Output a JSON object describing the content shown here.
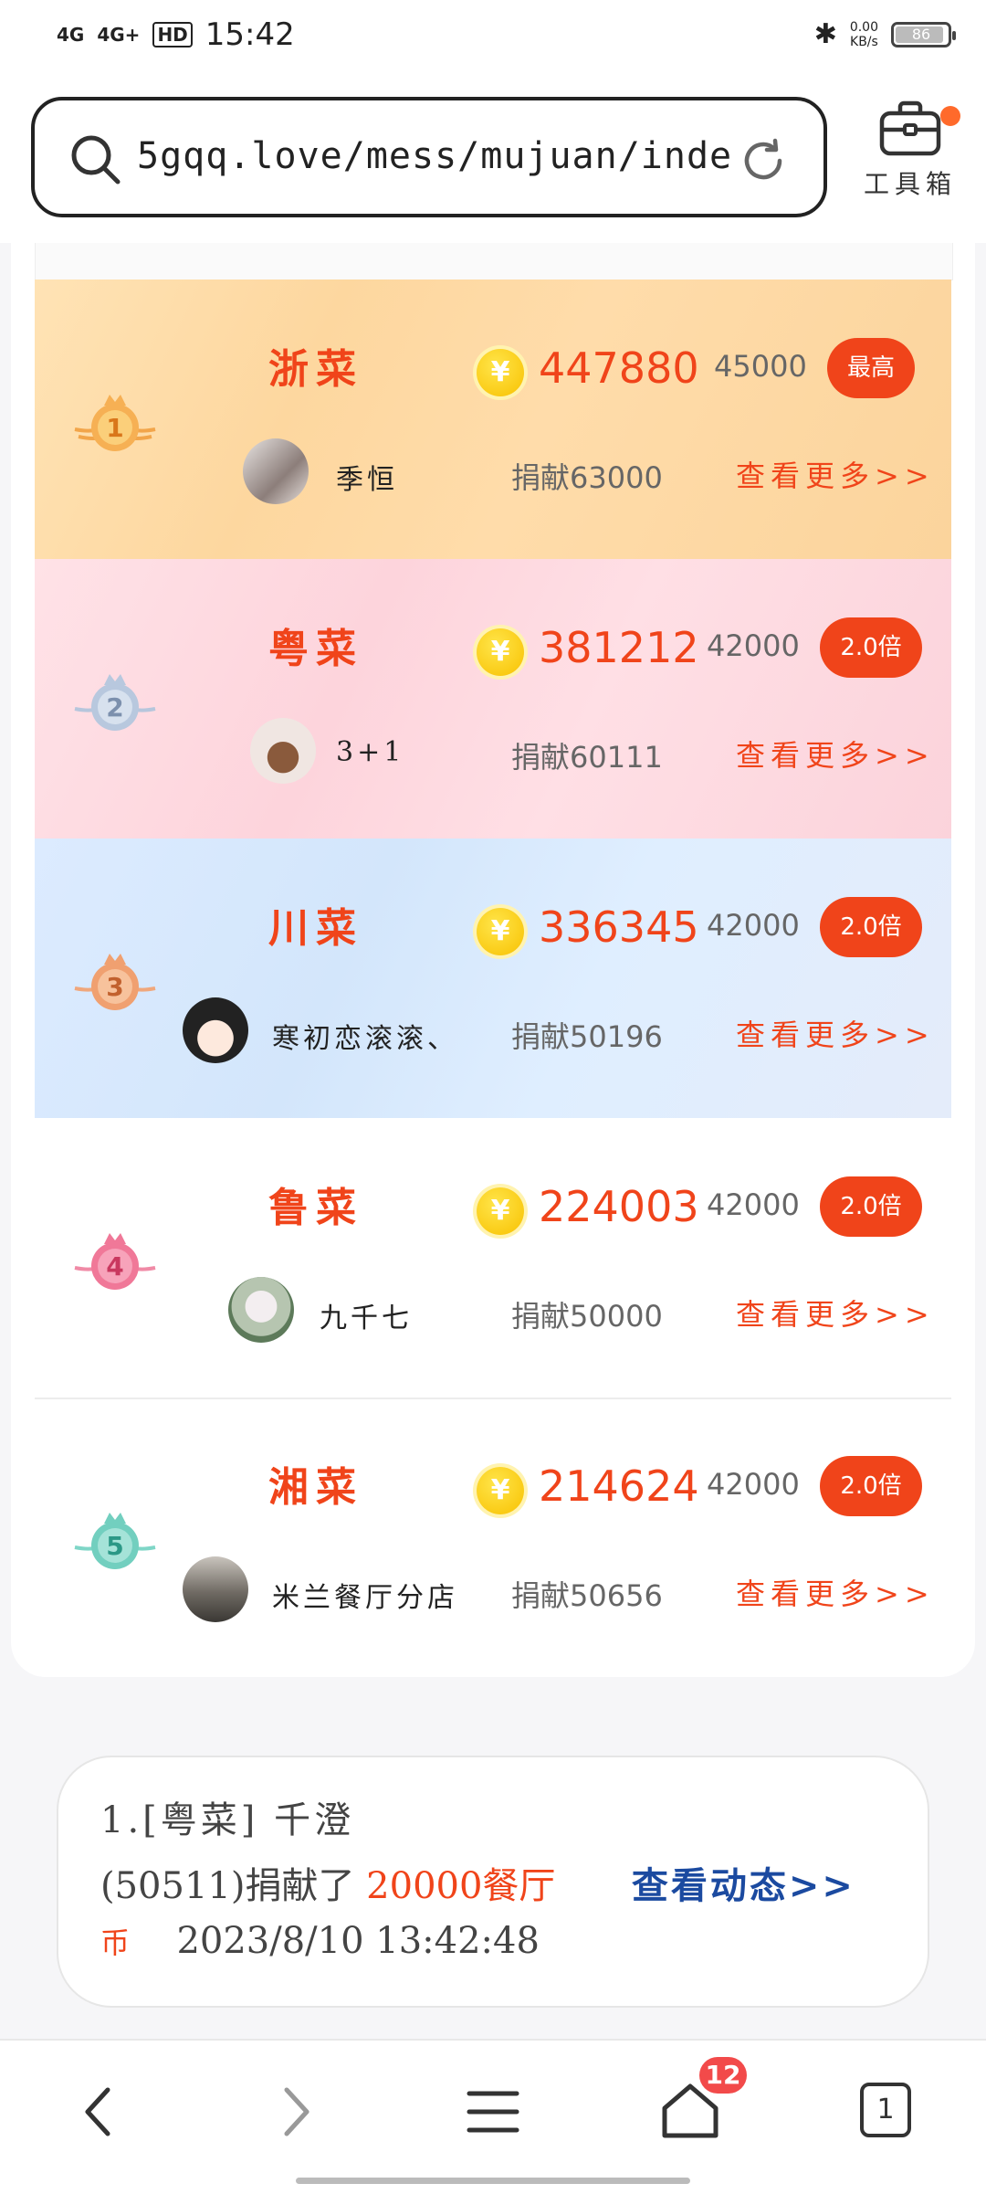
{
  "status_bar": {
    "signal1": "4G",
    "signal2": "4G+",
    "hd": "HD",
    "time": "15:42",
    "speed_value": "0.00",
    "speed_unit": "KB/s",
    "battery": "86"
  },
  "browser": {
    "url": "5gqq.love/mess/mujuan/inde…",
    "toolbox_label": "工具箱"
  },
  "ranking": [
    {
      "rank": 1,
      "cuisine": "浙菜",
      "score": "447880",
      "bid": "45000",
      "tag": "最高",
      "user": "季恒",
      "donation": "捐献63000",
      "more": "查看更多>>"
    },
    {
      "rank": 2,
      "cuisine": "粤菜",
      "score": "381212",
      "bid": "42000",
      "tag": "2.0倍",
      "user": "3+1",
      "donation": "捐献60111",
      "more": "查看更多>>"
    },
    {
      "rank": 3,
      "cuisine": "川菜",
      "score": "336345",
      "bid": "42000",
      "tag": "2.0倍",
      "user": "寒初恋滚滚、",
      "donation": "捐献50196",
      "more": "查看更多>>"
    },
    {
      "rank": 4,
      "cuisine": "鲁菜",
      "score": "224003",
      "bid": "42000",
      "tag": "2.0倍",
      "user": "九千七",
      "donation": "捐献50000",
      "more": "查看更多>>"
    },
    {
      "rank": 5,
      "cuisine": "湘菜",
      "score": "214624",
      "bid": "42000",
      "tag": "2.0倍",
      "user": "米兰餐厅分店",
      "donation": "捐献50656",
      "more": "查看更多>>"
    }
  ],
  "coin_symbol": "¥",
  "activity": {
    "line1": "1.[粤菜]  千澄",
    "line2_prefix": "(50511)捐献了 ",
    "amount": "20000餐厅",
    "link": "查看动态>>",
    "currency": "币",
    "timestamp": "2023/8/10 13:42:48"
  },
  "nav": {
    "tabs_badge": "12",
    "page_count": "1"
  },
  "colors": {
    "accent": "#f0441a",
    "link": "#1b4aa0",
    "gold_row": "#fdd79f",
    "pink_row": "#fdd4dc",
    "blue_row": "#d3e6fb"
  }
}
